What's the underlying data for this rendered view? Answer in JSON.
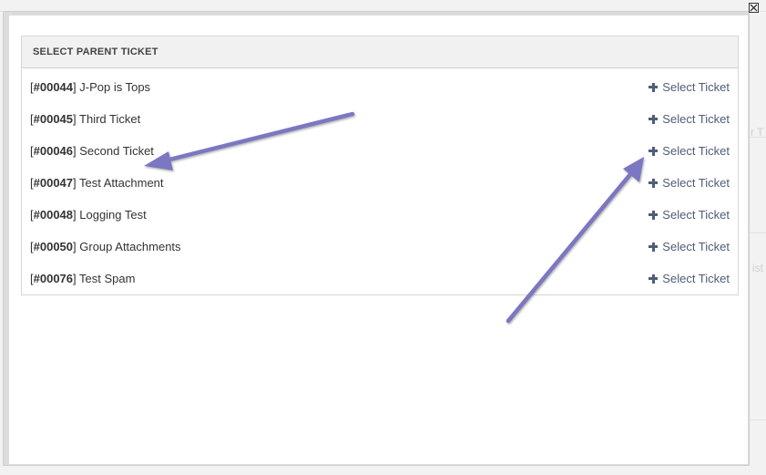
{
  "modal": {
    "title": "SELECT PARENT TICKET",
    "close_icon": "close-icon"
  },
  "tickets": [
    {
      "open": "[",
      "id": "#00044",
      "close": "]",
      "title": " J-Pop is Tops",
      "action": "Select Ticket"
    },
    {
      "open": "[",
      "id": "#00045",
      "close": "]",
      "title": " Third Ticket",
      "action": "Select Ticket"
    },
    {
      "open": "[",
      "id": "#00046",
      "close": "]",
      "title": " Second Ticket",
      "action": "Select Ticket"
    },
    {
      "open": "[",
      "id": "#00047",
      "close": "]",
      "title": " Test Attachment",
      "action": "Select Ticket"
    },
    {
      "open": "[",
      "id": "#00048",
      "close": "]",
      "title": " Logging Test",
      "action": "Select Ticket"
    },
    {
      "open": "[",
      "id": "#00050",
      "close": "]",
      "title": " Group Attachments",
      "action": "Select Ticket"
    },
    {
      "open": "[",
      "id": "#00076",
      "close": "]",
      "title": " Test Spam",
      "action": "Select Ticket"
    }
  ],
  "background": {
    "ghost_text_1": "r T",
    "ghost_text_2": "ist"
  },
  "colors": {
    "link": "#4e5d78",
    "annotation_arrow": "#7b77c2"
  },
  "annotations": {
    "arrow_icon": "annotation-arrow"
  }
}
